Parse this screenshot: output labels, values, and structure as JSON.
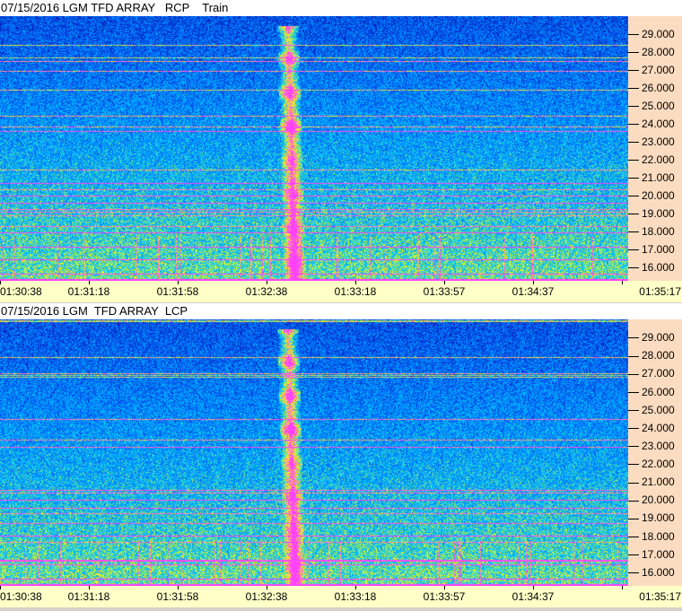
{
  "chart_data": [
    {
      "type": "heatmap",
      "title": "07/15/2016 LGM TFD ARRAY   RCP    Train",
      "y_ticks": [
        "29.000",
        "28.000",
        "27.000",
        "26.000",
        "25.000",
        "24.000",
        "23.000",
        "22.000",
        "21.000",
        "20.000",
        "19.000",
        "18.000",
        "17.000",
        "16.000"
      ],
      "ylim": [
        15.25,
        30.0
      ],
      "x_ticks": [
        "01:30:38",
        "01:31:18",
        "01:31:58",
        "01:32:38",
        "01:33:18",
        "01:33:57",
        "01:34:37",
        "01:35:17"
      ],
      "colormap": [
        "#000060",
        "#0020c0",
        "#0070ff",
        "#00d0ff",
        "#ffff00",
        "#ff40ff"
      ],
      "burst_time": "01:32:47",
      "burst_top": 29.5
    },
    {
      "type": "heatmap",
      "title": "07/15/2016 LGM  TFD ARRAY  LCP",
      "y_ticks": [
        "29.000",
        "28.000",
        "27.000",
        "26.000",
        "25.000",
        "24.000",
        "23.000",
        "22.000",
        "21.000",
        "20.000",
        "19.000",
        "18.000",
        "17.000",
        "16.000"
      ],
      "ylim": [
        15.25,
        30.0
      ],
      "x_ticks": [
        "01:30:38",
        "01:31:18",
        "01:31:58",
        "01:32:38",
        "01:33:18",
        "01:33:57",
        "01:34:37",
        "01:35:17"
      ],
      "colormap": [
        "#000060",
        "#0020c0",
        "#0070ff",
        "#00d0ff",
        "#ffff00",
        "#ff40ff"
      ],
      "burst_time": "01:32:47",
      "burst_top": 29.5
    }
  ]
}
